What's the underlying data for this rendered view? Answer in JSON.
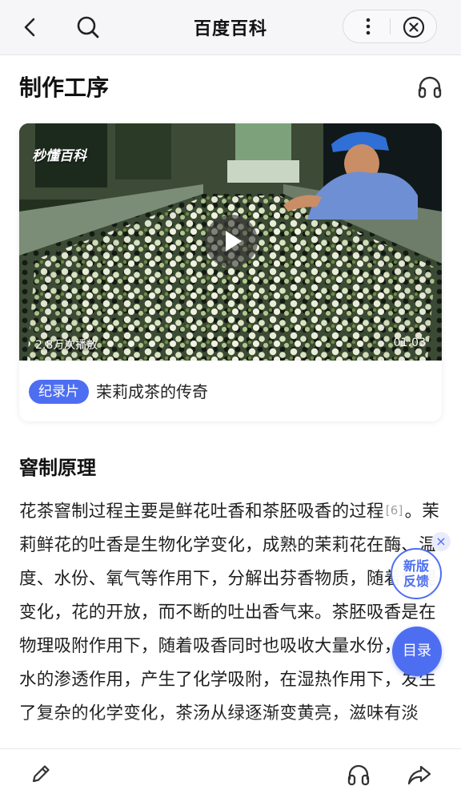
{
  "nav": {
    "title": "百度百科",
    "icons": [
      "back-icon",
      "search-icon",
      "more-icon",
      "close-circle-icon"
    ]
  },
  "section": {
    "title": "制作工序",
    "icon": "headphone-icon"
  },
  "video": {
    "watermark": "秒懂百科",
    "views": "2.8万次播放",
    "duration": "01:03",
    "badge": "纪录片",
    "title": "茉莉成茶的传奇"
  },
  "article": {
    "subtitle": "窨制原理",
    "text_before_ref": "花茶窨制过程主要是鲜花吐香和茶胚吸香的过程",
    "ref": "[6]",
    "text_after_ref": "。茉莉鲜花的吐香是生物化学变化，成熟的茉莉花在酶、温度、水份、氧气等作用下，分解出芬香物质，随着生理变化，花的开放，而不断的吐出香气来。茶胚吸香是在物理吸附作用下，随着吸香同时也吸收大量水份，由于水的渗透作用，产生了化学吸附，在湿热作用下，发生了复杂的化学变化，茶汤从绿逐渐变黄亮，滋味有淡"
  },
  "floating": {
    "feedback_line1": "新版",
    "feedback_line2": "反馈",
    "feedback_close": "×",
    "toc": "目录"
  },
  "bottombar": {
    "icons": [
      "edit-icon",
      "headphone-icon",
      "share-icon"
    ]
  },
  "colors": {
    "accent": "#4e6ef2",
    "text": "#1f1f1f",
    "nav_bg": "#f6f6f8"
  }
}
